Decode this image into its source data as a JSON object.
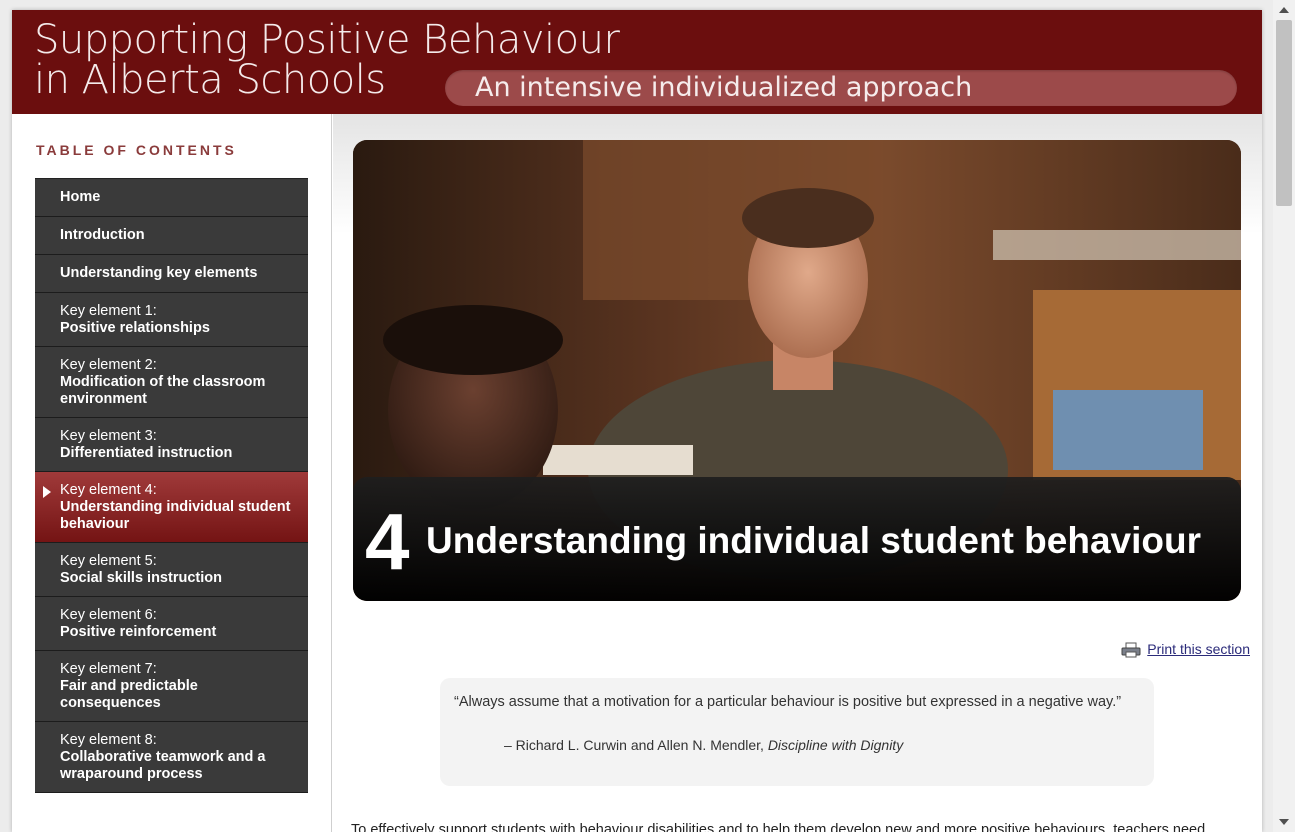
{
  "header": {
    "title_line1": "Supporting Positive Behaviour",
    "title_line2": "in Alberta Schools",
    "tagline": "An intensive individualized approach"
  },
  "sidebar": {
    "toc_title": "TABLE OF CONTENTS",
    "items": [
      {
        "label": "Home"
      },
      {
        "label": "Introduction"
      },
      {
        "label": "Understanding key elements"
      },
      {
        "kicker": "Key element 1:",
        "label": "Positive relationships"
      },
      {
        "kicker": "Key element 2:",
        "label": "Modification of the classroom environment"
      },
      {
        "kicker": "Key element 3:",
        "label": "Differentiated instruction"
      },
      {
        "kicker": "Key element 4:",
        "label": "Understanding individual student behaviour"
      },
      {
        "kicker": "Key element 5:",
        "label": "Social skills instruction"
      },
      {
        "kicker": "Key element 6:",
        "label": "Positive reinforcement"
      },
      {
        "kicker": "Key element 7:",
        "label": "Fair and predictable consequences"
      },
      {
        "kicker": "Key element 8:",
        "label": "Collaborative teamwork and a wraparound process"
      }
    ]
  },
  "hero": {
    "number": "4",
    "title": "Understanding individual student behaviour"
  },
  "print": {
    "label": "Print this section"
  },
  "quote": {
    "text": "“Always assume that a motivation for a particular behaviour is positive but expressed in a negative way.”",
    "attribution": "– Richard L. Curwin and Allen N. Mendler, ",
    "source": "Discipline with Dignity"
  },
  "body": {
    "paragraph": "To effectively support students with behaviour disabilities and to help them develop new and more positive behaviours, teachers need"
  },
  "colors": {
    "header_bg": "#6b0e0e",
    "active_item": "#8a2424",
    "nav_bg": "#3a3a3a",
    "link": "#2b2b7a"
  }
}
